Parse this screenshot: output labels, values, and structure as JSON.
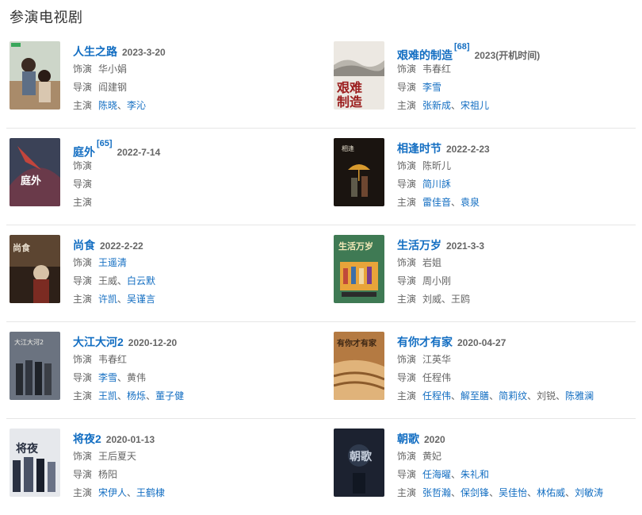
{
  "section_title": "参演电视剧",
  "labels": {
    "role": "饰演",
    "director": "导演",
    "cast": "主演",
    "sep": "、"
  },
  "colors": {
    "link": "#136ec2",
    "text": "#666666",
    "divider": "#e6e6e6"
  },
  "rows": [
    {
      "left": {
        "title": "人生之路",
        "ref": "",
        "date": "2023-3-20",
        "role": [
          {
            "text": "华小娟",
            "link": false
          }
        ],
        "director": [
          {
            "text": "阎建钢",
            "link": false
          }
        ],
        "cast": [
          {
            "text": "陈晓",
            "link": true
          },
          {
            "text": "李沁",
            "link": true
          }
        ]
      },
      "right": {
        "title": "艰难的制造",
        "ref": "[68]",
        "date": "2023(开机时间)",
        "role": [
          {
            "text": "韦春红",
            "link": false
          }
        ],
        "director": [
          {
            "text": "李雪",
            "link": true
          }
        ],
        "cast": [
          {
            "text": "张新成",
            "link": true
          },
          {
            "text": "宋祖儿",
            "link": true
          }
        ]
      }
    },
    {
      "left": {
        "title": "庭外",
        "ref": "[65]",
        "date": "2022-7-14",
        "role": [],
        "director": [],
        "cast": []
      },
      "right": {
        "title": "相逢时节",
        "ref": "",
        "date": "2022-2-23",
        "role": [
          {
            "text": "陈昕儿",
            "link": false
          }
        ],
        "director": [
          {
            "text": "简川訸",
            "link": true
          }
        ],
        "cast": [
          {
            "text": "雷佳音",
            "link": true
          },
          {
            "text": "袁泉",
            "link": true
          }
        ]
      }
    },
    {
      "left": {
        "title": "尚食",
        "ref": "",
        "date": "2022-2-22",
        "role": [
          {
            "text": "王遥清",
            "link": true
          }
        ],
        "director": [
          {
            "text": "王威",
            "link": false
          },
          {
            "text": "白云默",
            "link": true
          }
        ],
        "cast": [
          {
            "text": "许凯",
            "link": true
          },
          {
            "text": "吴谨言",
            "link": true
          }
        ]
      },
      "right": {
        "title": "生活万岁",
        "ref": "",
        "date": "2021-3-3",
        "role": [
          {
            "text": "岩姐",
            "link": false
          }
        ],
        "director": [
          {
            "text": "周小刚",
            "link": false
          }
        ],
        "cast": [
          {
            "text": "刘威",
            "link": false
          },
          {
            "text": "王鸥",
            "link": false
          }
        ]
      }
    },
    {
      "left": {
        "title": "大江大河2",
        "ref": "",
        "date": "2020-12-20",
        "role": [
          {
            "text": "韦春红",
            "link": false
          }
        ],
        "director": [
          {
            "text": "李雪",
            "link": true
          },
          {
            "text": "黄伟",
            "link": false
          }
        ],
        "cast": [
          {
            "text": "王凯",
            "link": true
          },
          {
            "text": "杨烁",
            "link": true
          },
          {
            "text": "董子健",
            "link": true
          }
        ]
      },
      "right": {
        "title": "有你才有家",
        "ref": "",
        "date": "2020-04-27",
        "role": [
          {
            "text": "江英华",
            "link": false
          }
        ],
        "director": [
          {
            "text": "任程伟",
            "link": false
          }
        ],
        "cast": [
          {
            "text": "任程伟",
            "link": true
          },
          {
            "text": "解至膳",
            "link": true
          },
          {
            "text": "简莉纹",
            "link": true
          },
          {
            "text": "刘锐",
            "link": false
          },
          {
            "text": "陈雅澜",
            "link": true
          }
        ]
      }
    },
    {
      "left": {
        "title": "将夜2",
        "ref": "",
        "date": "2020-01-13",
        "role": [
          {
            "text": "王后夏天",
            "link": false
          }
        ],
        "director": [
          {
            "text": "杨阳",
            "link": false
          }
        ],
        "cast": [
          {
            "text": "宋伊人",
            "link": true
          },
          {
            "text": "王鹤棣",
            "link": true
          }
        ]
      },
      "right": {
        "title": "朝歌",
        "ref": "",
        "date": "2020",
        "role": [
          {
            "text": "黄妃",
            "link": false
          }
        ],
        "director": [
          {
            "text": "任海曜",
            "link": true
          },
          {
            "text": "朱礼和",
            "link": true
          }
        ],
        "cast": [
          {
            "text": "张哲瀚",
            "link": true
          },
          {
            "text": "保剑锋",
            "link": true
          },
          {
            "text": "吴佳怡",
            "link": true
          },
          {
            "text": "林佑威",
            "link": true
          },
          {
            "text": "刘敏涛",
            "link": true
          }
        ]
      }
    }
  ],
  "posters": [
    {
      "icon": "poster-renshengzhilu",
      "bg": "#cdd6c9",
      "fg": "#7c5a3f"
    },
    {
      "icon": "poster-jiannan",
      "bg": "#ece8e2",
      "fg": "#9b1d1d",
      "text": "艰难制造"
    },
    {
      "icon": "poster-tingwai",
      "bg": "#3b4257",
      "fg": "#c2453c",
      "text": "庭外"
    },
    {
      "icon": "poster-xiangfeng",
      "bg": "#1a1410",
      "fg": "#d89a2e"
    },
    {
      "icon": "poster-shangshi",
      "bg": "#5c4531",
      "fg": "#e9dfcf",
      "text": "尚食"
    },
    {
      "icon": "poster-shenghuo",
      "bg": "#3f7a54",
      "fg": "#f3e9b8",
      "text": "生活万岁"
    },
    {
      "icon": "poster-dajiang",
      "bg": "#6b7380",
      "fg": "#f0efe8"
    },
    {
      "icon": "poster-youni",
      "bg": "#b47a42",
      "fg": "#3d2715"
    },
    {
      "icon": "poster-jiangye",
      "bg": "#e6e8ec",
      "fg": "#2a3142"
    },
    {
      "icon": "poster-zhaoge",
      "bg": "#1c2230",
      "fg": "#c6cfdc"
    }
  ]
}
